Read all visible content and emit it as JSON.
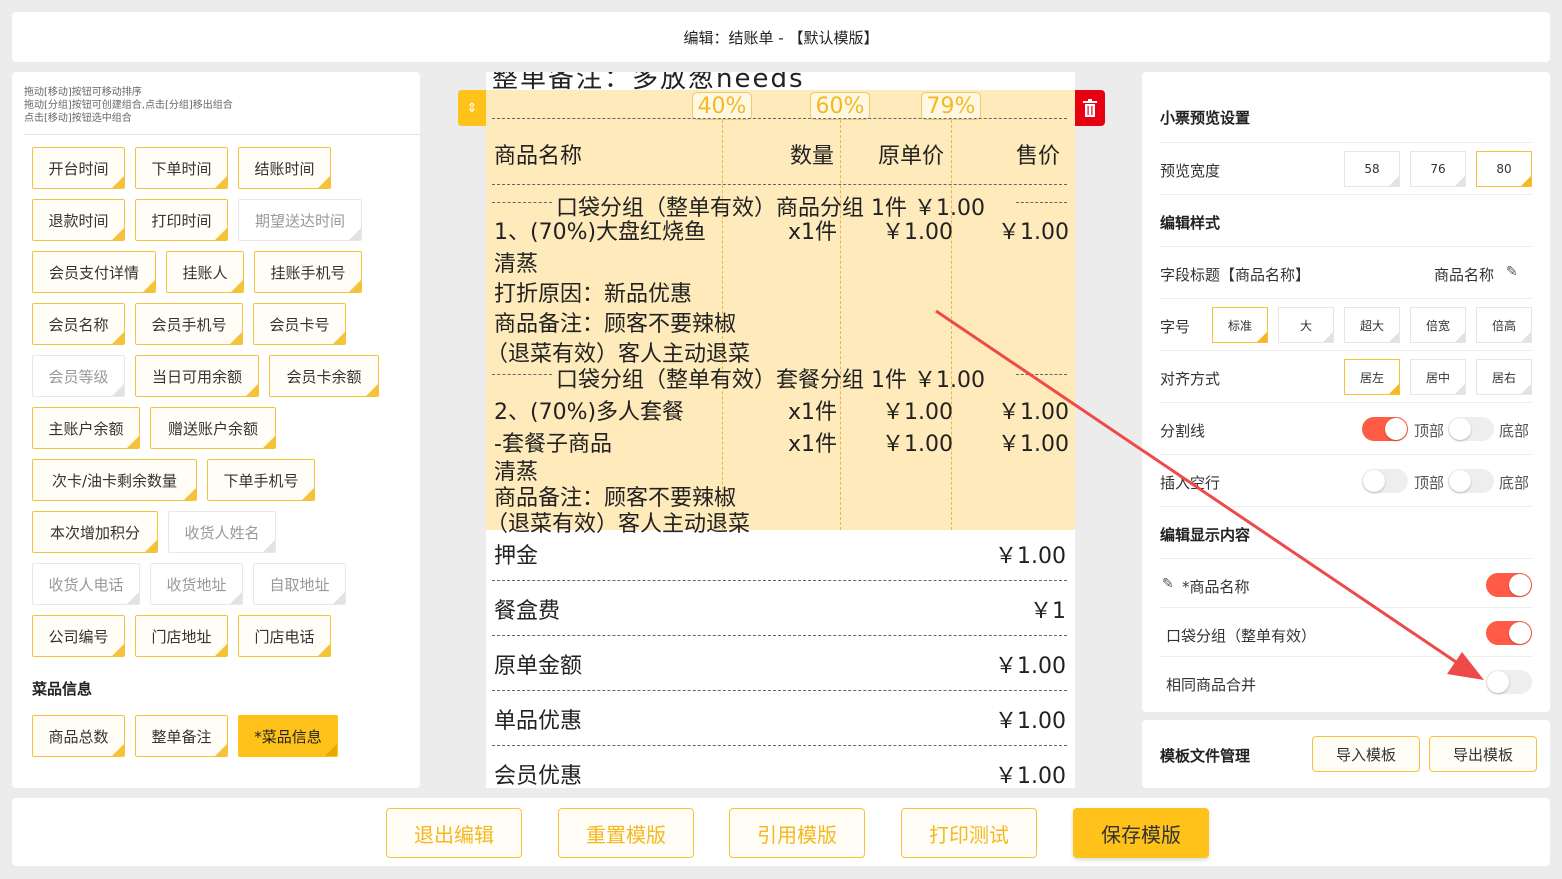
{
  "header": {
    "title": "编辑：结账单 - 【默认模版】"
  },
  "left": {
    "hints": [
      "拖动[移动]按钮可移动排序",
      "拖动[分组]按钮可创建组合,点击[分组]移出组合",
      "点击[移动]按钮选中组合"
    ],
    "chips": [
      "开台时间",
      "下单时间",
      "结账时间",
      "退款时间",
      "打印时间",
      "期望送达时间",
      "会员支付详情",
      "挂账人",
      "挂账手机号",
      "会员名称",
      "会员手机号",
      "会员卡号",
      "会员等级",
      "当日可用余额",
      "会员卡余额",
      "主账户余额",
      "赠送账户余额",
      "次卡/油卡剩余数量",
      "下单手机号",
      "本次增加积分",
      "收货人姓名",
      "收货人电话",
      "收货地址",
      "自取地址",
      "公司编号",
      "门店地址",
      "门店电话"
    ],
    "section_title": "菜品信息",
    "dish_chips": [
      "商品总数",
      "整单备注",
      "*菜品信息"
    ]
  },
  "receipt": {
    "cut_text": "整单备注：多放葱needs",
    "percents": [
      "40%",
      "60%",
      "79%"
    ],
    "header_cols": [
      "商品名称",
      "数量",
      "原单价",
      "售价"
    ],
    "group1": "口袋分组（整单有效）商品分组 1件 ￥1.00",
    "item1": {
      "name": "1、(70%)大盘红烧鱼",
      "qty": "x1件",
      "price": "￥1.00",
      "sale": "￥1.00"
    },
    "item1_lines": [
      "清蒸",
      "打折原因：新品优惠",
      "商品备注：顾客不要辣椒",
      "（退菜有效）客人主动退菜"
    ],
    "group2": "口袋分组（整单有效）套餐分组 1件 ￥1.00",
    "item2": {
      "name": "2、(70%)多人套餐",
      "qty": "x1件",
      "price": "￥1.00",
      "sale": "￥1.00"
    },
    "item3": {
      "name": "-套餐子商品",
      "qty": "x1件",
      "price": "￥1.00",
      "sale": "￥1.00"
    },
    "item3_lines": [
      "清蒸",
      "商品备注：顾客不要辣椒",
      "（退菜有效）客人主动退菜"
    ],
    "summary": [
      {
        "label": "押金",
        "value": "￥1.00"
      },
      {
        "label": "餐盒费",
        "value": "￥1"
      },
      {
        "label": "原单金额",
        "value": "￥1.00"
      },
      {
        "label": "单品优惠",
        "value": "￥1.00"
      },
      {
        "label": "会员优惠",
        "value": "￥1.00"
      }
    ]
  },
  "settings": {
    "preview_title": "小票预览设置",
    "width_label": "预览宽度",
    "widths": [
      "58",
      "76",
      "80"
    ],
    "style_title": "编辑样式",
    "field_title_label": "字段标题【商品名称】",
    "field_title_value": "商品名称",
    "font_label": "字号",
    "fonts": [
      "标准",
      "大",
      "超大",
      "倍宽",
      "倍高"
    ],
    "align_label": "对齐方式",
    "aligns": [
      "居左",
      "居中",
      "居右"
    ],
    "divider_label": "分割线",
    "blank_label": "插入空行",
    "top": "顶部",
    "bottom": "底部",
    "content_title": "编辑显示内容",
    "content_items": [
      "*商品名称",
      "口袋分组（整单有效）",
      "相同商品合并"
    ],
    "file_title": "模板文件管理",
    "import_btn": "导入模板",
    "export_btn": "导出模板"
  },
  "footer": {
    "buttons": [
      "退出编辑",
      "重置模版",
      "引用模版",
      "打印测试",
      "保存模版"
    ]
  },
  "colors": {
    "accent": "#ffc21a",
    "toggle_on": "#ff5b45",
    "delete": "#e60012",
    "highlight": "#feeabb",
    "arrow": "#ee4a4a"
  }
}
